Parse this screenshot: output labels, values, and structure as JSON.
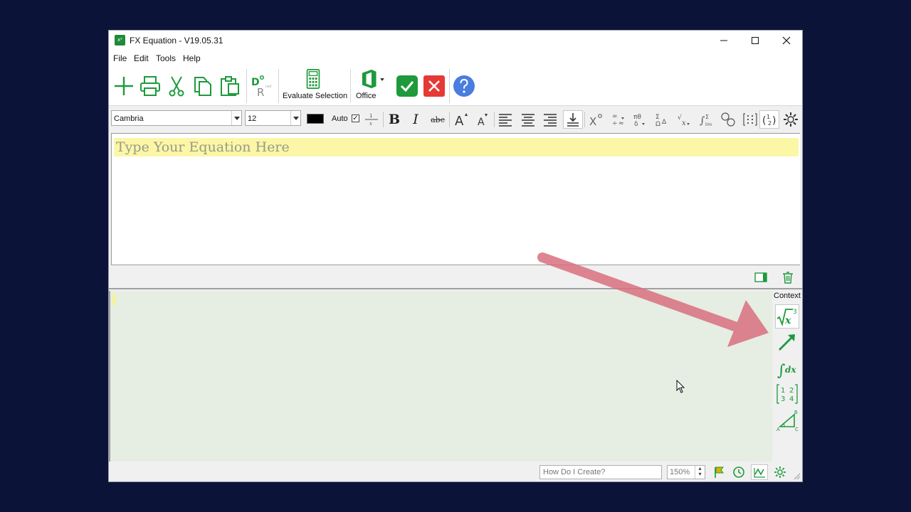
{
  "window": {
    "title": "FX Equation - V19.05.31",
    "icon": "fx-equation-app-icon",
    "icon_text": "x²"
  },
  "menu": [
    "File",
    "Edit",
    "Tools",
    "Help"
  ],
  "ribbon": {
    "evaluate_label": "Evaluate Selection",
    "office_label": "Office"
  },
  "format": {
    "font": "Cambria",
    "size": "12",
    "auto_label": "Auto",
    "auto_checked": "✓",
    "color": "#000000"
  },
  "editor": {
    "placeholder": "Type Your Equation Here"
  },
  "context": {
    "label": "Context"
  },
  "status": {
    "help_placeholder": "How Do I Create?",
    "zoom": "150%"
  },
  "colors": {
    "accent_green": "#1e9a3c",
    "cancel_red": "#e53935",
    "help_blue": "#4a7de0",
    "placeholder_bg": "#fbf7a6",
    "graph_bg": "#e6ede3",
    "annotation_arrow": "#d9707f"
  }
}
